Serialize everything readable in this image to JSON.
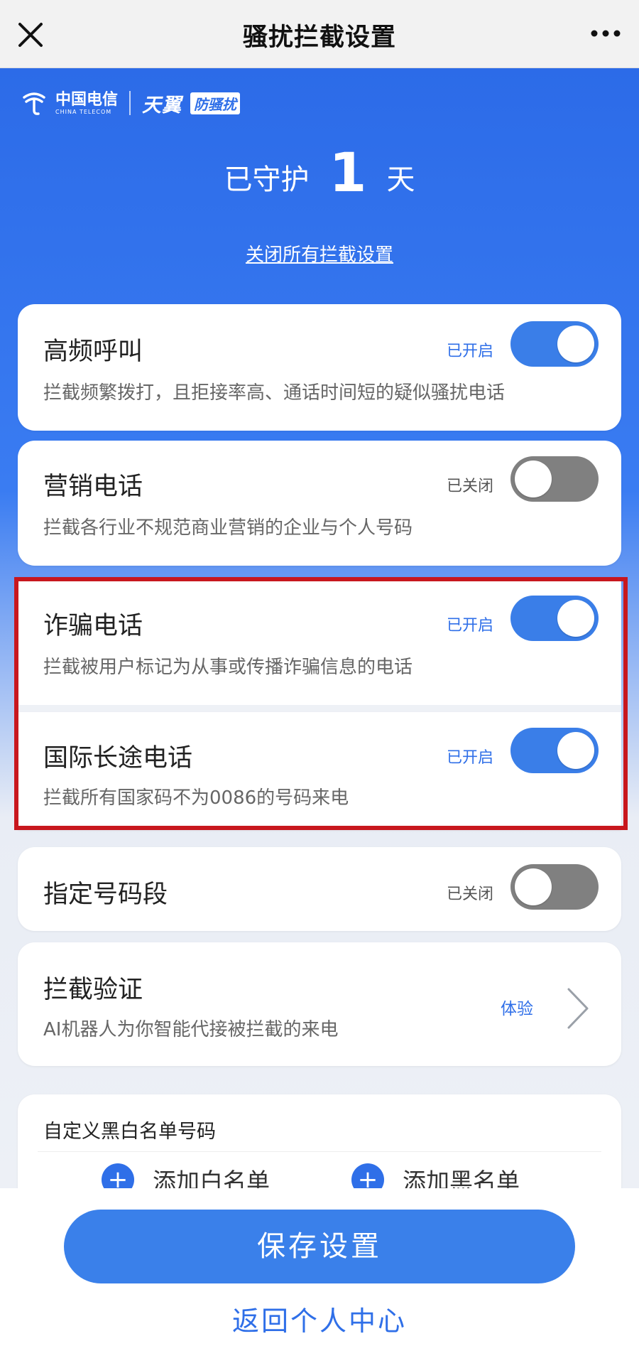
{
  "topbar": {
    "title": "骚扰拦截设置"
  },
  "brand": {
    "carrier_cn": "中国电信",
    "carrier_en": "CHINA TELECOM",
    "product": "天翼",
    "product_sub": "防骚扰"
  },
  "guard": {
    "prefix": "已守护",
    "days": "1",
    "suffix": "天"
  },
  "close_all": "关闭所有拦截设置",
  "cards": [
    {
      "title": "高频呼叫",
      "desc": "拦截频繁拨打，且拒接率高、通话时间短的疑似骚扰电话",
      "status": "已开启",
      "on": true
    },
    {
      "title": "营销电话",
      "desc": "拦截各行业不规范商业营销的企业与个人号码",
      "status": "已关闭",
      "on": false
    },
    {
      "title": "诈骗电话",
      "desc": "拦截被用户标记为从事或传播诈骗信息的电话",
      "status": "已开启",
      "on": true
    },
    {
      "title": "国际长途电话",
      "desc": "拦截所有国家码不为0086的号码来电",
      "status": "已开启",
      "on": true
    },
    {
      "title": "指定号码段",
      "status": "已关闭",
      "on": false
    }
  ],
  "verify": {
    "title": "拦截验证",
    "desc": "AI机器人为你智能代接被拦截的来电",
    "action": "体验"
  },
  "custom_list": {
    "title": "自定义黑白名单号码",
    "add_white": "添加白名单",
    "add_black": "添加黑名单"
  },
  "bottom": {
    "save": "保存设置",
    "back": "返回个人中心"
  },
  "colors": {
    "accent": "#2f6fe8",
    "highlight_border": "#c8171e",
    "toggle_off": "#808080"
  }
}
